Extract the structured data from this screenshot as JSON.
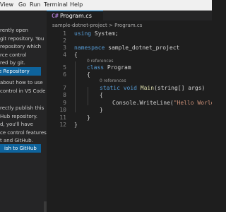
{
  "menubar": {
    "items": [
      "View",
      "Go",
      "Run",
      "Terminal",
      "Help"
    ]
  },
  "sidebar": {
    "paragraph1": "rently open\ngit repository. You\nrepository which\nrce control\nred by git.",
    "initialize_button": "e Repository",
    "paragraph2": "about how to use\ncontrol in VS Code",
    "paragraph3": "rectly publish this\nHub repository.\nd, you'll have\nce control features\nt and GitHub.",
    "publish_button": "ish to GitHub"
  },
  "editor": {
    "tab": {
      "icon": "C#",
      "label": "Program.cs",
      "close": "×"
    },
    "breadcrumb": {
      "folder": "sample-dotnet-project",
      "separator": ">",
      "file": "Program.cs"
    },
    "line_numbers": [
      "1",
      "2",
      "3",
      "4",
      "5",
      "6",
      "7",
      "8",
      "9",
      "10",
      "11",
      "12"
    ],
    "refs": {
      "class": "0 references",
      "method": "0 references"
    },
    "code": {
      "l1_kw": "using",
      "l1_rest": " System;",
      "l3_kw": "namespace",
      "l3_rest": " sample_dotnet_project",
      "l4": "{",
      "l5_kw": "class",
      "l5_rest": " Program",
      "l6": "{",
      "l7_kw": "static void",
      "l7_fn": " Main",
      "l7_rest": "(string[] args)",
      "l8": "{",
      "l9_call": "Console.WriteLine(",
      "l9_str": "\"Hello World!\"",
      "l9_end": ");",
      "l10": "}",
      "l11": "}",
      "l12": "}"
    }
  }
}
